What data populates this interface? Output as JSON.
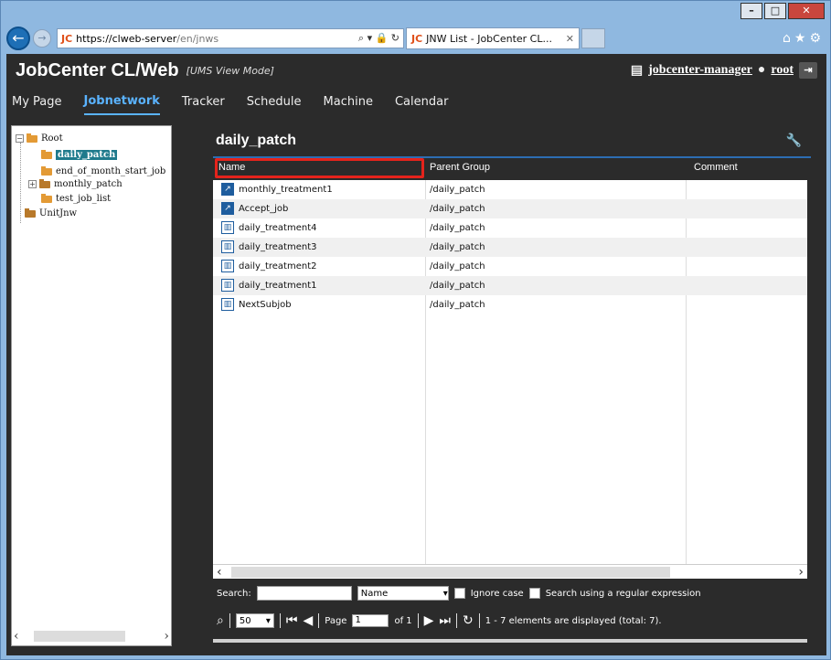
{
  "browser": {
    "url_host": "https://clweb-server",
    "url_path": "/en/jnws",
    "url_brand": "JC",
    "tab_label": "JNW List - JobCenter CL...",
    "tab_brand": "JC"
  },
  "app": {
    "title": "JobCenter CL/Web",
    "mode": "[UMS View Mode]",
    "manager": "jobcenter-manager",
    "user": "root"
  },
  "menu": [
    {
      "label": "My Page"
    },
    {
      "label": "Jobnetwork"
    },
    {
      "label": "Tracker"
    },
    {
      "label": "Schedule"
    },
    {
      "label": "Machine"
    },
    {
      "label": "Calendar"
    }
  ],
  "menu_active": "Jobnetwork",
  "tree": {
    "root": "Root",
    "children": [
      "daily_patch",
      "end_of_month_start_job",
      "monthly_patch",
      "test_job_list"
    ],
    "unit": "UnitJnw"
  },
  "panel": {
    "title": "daily_patch",
    "columns": [
      "Name",
      "Parent Group",
      "Comment"
    ]
  },
  "rows": [
    {
      "name": "monthly_treatment1",
      "group": "/daily_patch",
      "type": "jnw"
    },
    {
      "name": "Accept_job",
      "group": "/daily_patch",
      "type": "jnw"
    },
    {
      "name": "daily_treatment4",
      "group": "/daily_patch",
      "type": "group"
    },
    {
      "name": "daily_treatment3",
      "group": "/daily_patch",
      "type": "group"
    },
    {
      "name": "daily_treatment2",
      "group": "/daily_patch",
      "type": "group"
    },
    {
      "name": "daily_treatment1",
      "group": "/daily_patch",
      "type": "group"
    },
    {
      "name": "NextSubjob",
      "group": "/daily_patch",
      "type": "group"
    }
  ],
  "search": {
    "label": "Search:",
    "field_value": "Name",
    "ignore_case": "Ignore case",
    "regex": "Search using a regular expression"
  },
  "pager": {
    "page_size": "50",
    "page_label": "Page",
    "page_value": "1",
    "of_label": "of 1",
    "status": "1 - 7 elements are displayed (total: 7)."
  }
}
